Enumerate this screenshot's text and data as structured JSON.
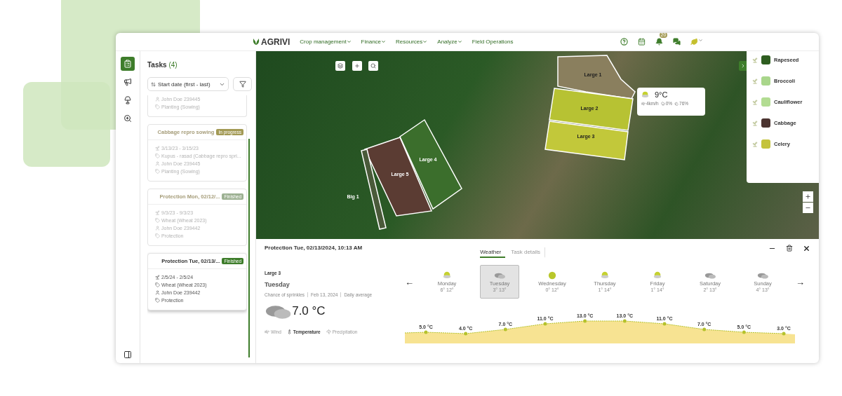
{
  "nav": {
    "logo": "AGRIVI",
    "menu": [
      {
        "label": "Crop management",
        "has_menu": true
      },
      {
        "label": "Finance",
        "has_menu": true
      },
      {
        "label": "Resources",
        "has_menu": true
      },
      {
        "label": "Analyze",
        "has_menu": true
      },
      {
        "label": "Field Operations",
        "has_menu": false
      }
    ],
    "notifications": "20"
  },
  "rail": [
    {
      "kind": "clipboard",
      "selected": true
    },
    {
      "kind": "megaphone",
      "selected": false
    },
    {
      "kind": "lamp",
      "selected": false
    },
    {
      "kind": "zoom",
      "selected": false
    }
  ],
  "tasks": {
    "title": "Tasks",
    "count": "(4)",
    "sort": "Start date (first - last)",
    "items": [
      {
        "selected": false,
        "assignee": "John Doe 239445",
        "type": "Planting (Sowing)"
      },
      {
        "selected": false,
        "title": "Cabbage repro sowing",
        "status": {
          "label": "In progress",
          "kind": "progress"
        },
        "dates": "3/13/23 - 3/15/23",
        "crop": "Kupus - rasad (Cabbage repro spri...",
        "assignee": "John Doe 239445",
        "type": "Planting (Sowing)"
      },
      {
        "selected": false,
        "title": "Protection Mon, 02/12/...",
        "status": {
          "label": "Finished",
          "kind": "done"
        },
        "dates": "9/3/23 - 9/3/23",
        "crop": "Wheat (Wheat 2023)",
        "assignee": "John Doe 239442",
        "type": "Protection"
      },
      {
        "selected": true,
        "title": "Protection Tue, 02/13/...",
        "status": {
          "label": "Finished",
          "kind": "done"
        },
        "dates": "2/5/24 - 2/5/24",
        "crop": "Wheat (Wheat 2023)",
        "assignee": "John Doe 239442",
        "type": "Protection"
      }
    ]
  },
  "map": {
    "fields": [
      {
        "label": "Large 1",
        "color": "#8a7f5e"
      },
      {
        "label": "Large 2",
        "color": "#b7c233"
      },
      {
        "label": "Large 3",
        "color": "#c2c83a"
      },
      {
        "label": "Large 4",
        "color": "#3b6e2c"
      },
      {
        "label": "Large 5",
        "color": "#5b3c33"
      },
      {
        "label": "Big 1",
        "color": "#4a5a3a"
      }
    ],
    "weather": {
      "temp": "9°C",
      "wind": "4km/h",
      "rain": "0%",
      "humidity": "76%"
    },
    "legend": [
      {
        "label": "Rapeseed",
        "color": "#2e5d20"
      },
      {
        "label": "Broccoli",
        "color": "#a9d68b"
      },
      {
        "label": "Cauliflower",
        "color": "#b2dc92"
      },
      {
        "label": "Cabbage",
        "color": "#4b3430"
      },
      {
        "label": "Celery",
        "color": "#c4c33c"
      }
    ]
  },
  "detail": {
    "title": "Protection Tue, 02/13/2024, 10:13 AM",
    "tabs": [
      {
        "label": "Weather",
        "selected": true
      },
      {
        "label": "Task details",
        "selected": false
      }
    ],
    "field": "Large 3",
    "day": "Tuesday",
    "meta": [
      "Chance of sprinkles",
      "Feb 13, 2024",
      "Daily average"
    ],
    "temp": "7.0 °C",
    "metrics": [
      {
        "label": "Wind",
        "kind": "wind",
        "selected": false
      },
      {
        "label": "Temperature",
        "kind": "temperature",
        "selected": true
      },
      {
        "label": "Precipitation",
        "kind": "precipitation",
        "selected": false
      }
    ],
    "prev": "←",
    "next": "→",
    "days": [
      {
        "name": "Monday",
        "range": "6° 12°",
        "kind": "sun-cloud",
        "selected": false
      },
      {
        "name": "Tuesday",
        "range": "3° 13°",
        "kind": "cloud",
        "selected": true
      },
      {
        "name": "Wednesday",
        "range": "0° 12°",
        "kind": "sun",
        "selected": false
      },
      {
        "name": "Thursday",
        "range": "1° 14°",
        "kind": "sun-cloud",
        "selected": false
      },
      {
        "name": "Friday",
        "range": "1° 14°",
        "kind": "sun-cloud",
        "selected": false
      },
      {
        "name": "Saturday",
        "range": "2° 13°",
        "kind": "cloud",
        "selected": false
      },
      {
        "name": "Sunday",
        "range": "4° 13°",
        "kind": "cloud",
        "selected": false
      }
    ],
    "temperature_labels": [
      "5.0 °C",
      "4.0 °C",
      "7.0 °C",
      "11.0 °C",
      "13.0 °C",
      "13.0 °C",
      "11.0 °C",
      "7.0 °C",
      "5.0 °C",
      "3.0 °C"
    ]
  }
}
